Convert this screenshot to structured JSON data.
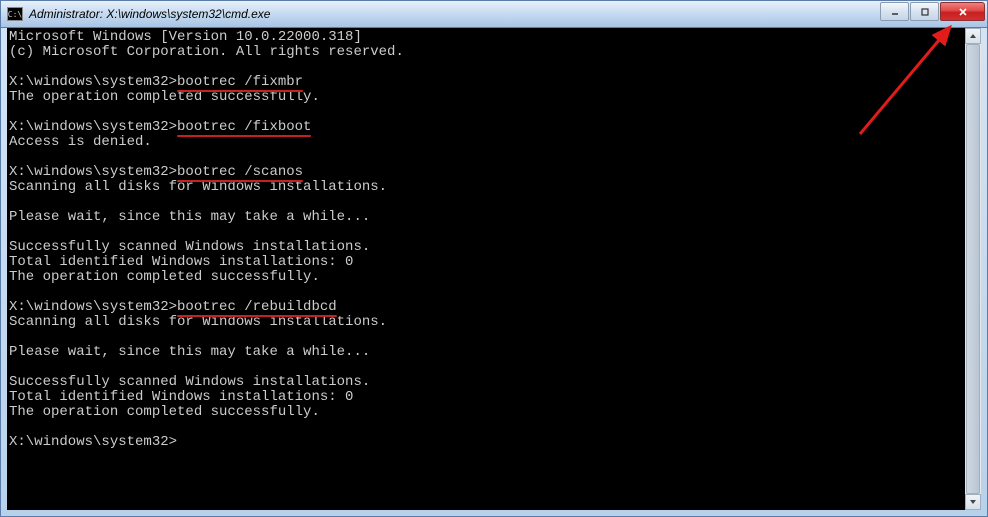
{
  "window": {
    "title": "Administrator: X:\\windows\\system32\\cmd.exe",
    "icon_label": "C:\\"
  },
  "console": {
    "header1": "Microsoft Windows [Version 10.0.22000.318]",
    "header2": "(c) Microsoft Corporation. All rights reserved.",
    "prompt": "X:\\windows\\system32>",
    "cmd1": "bootrec /fixmbr",
    "out1": "The operation completed successfully.",
    "cmd2": "bootrec /fixboot",
    "out2": "Access is denied.",
    "cmd3": "bootrec /scanos",
    "out3a": "Scanning all disks for Windows installations.",
    "out3b": "Please wait, since this may take a while...",
    "out3c": "Successfully scanned Windows installations.",
    "out3d": "Total identified Windows installations: 0",
    "out3e": "The operation completed successfully.",
    "cmd4": "bootrec /rebuildbcd",
    "out4a": "Scanning all disks for Windows installations.",
    "out4b": "Please wait, since this may take a while...",
    "out4c": "Successfully scanned Windows installations.",
    "out4d": "Total identified Windows installations: 0",
    "out4e": "The operation completed successfully."
  },
  "annotation": {
    "arrow_color": "#e21b1b"
  }
}
